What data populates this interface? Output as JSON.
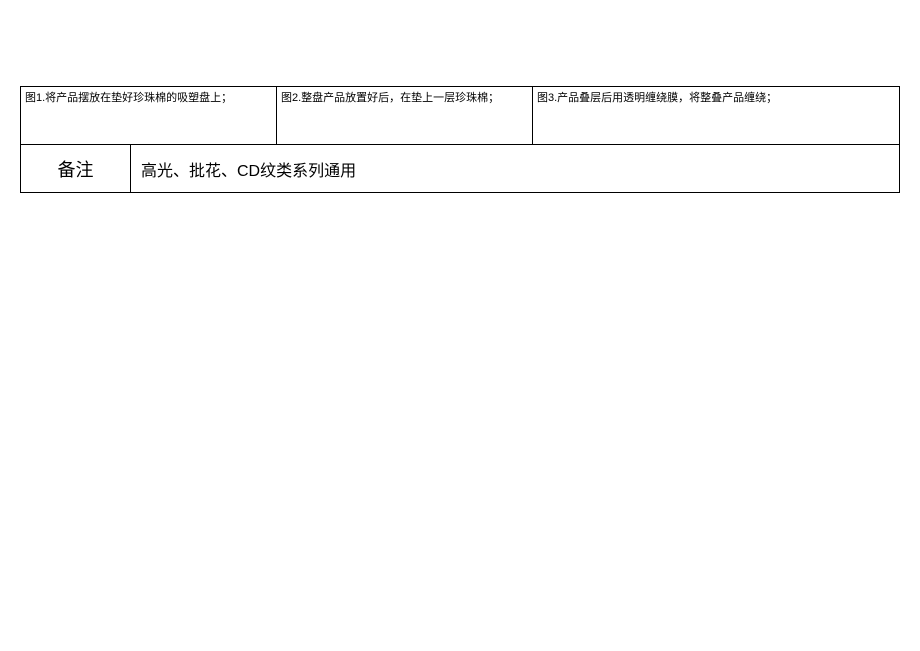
{
  "figures": {
    "fig1": "图1.将产品摆放在垫好珍珠棉的吸塑盘上；",
    "fig2": "图2.整盘产品放置好后，在垫上一层珍珠棉；",
    "fig3": "图3.产品叠层后用透明缠绕膜，将整叠产品缠绕；"
  },
  "remark": {
    "label": "备注",
    "content": "高光、批花、CD纹类系列通用"
  }
}
